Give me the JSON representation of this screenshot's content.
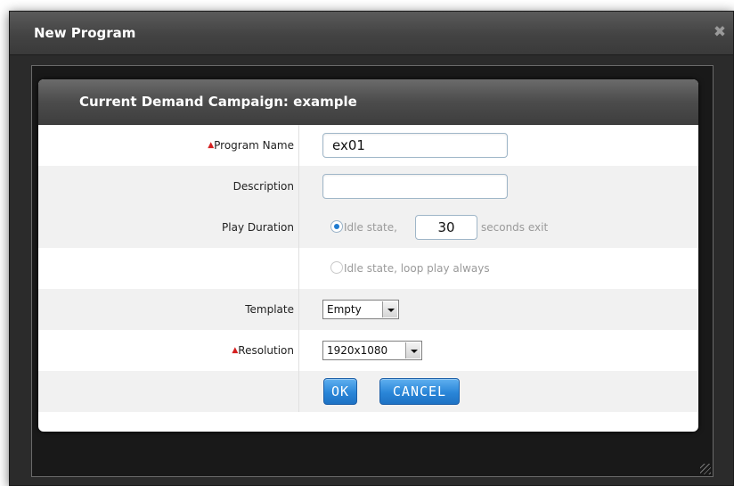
{
  "window": {
    "title": "New Program"
  },
  "dialog": {
    "title": "Current Demand Campaign: example"
  },
  "form": {
    "program_name": {
      "label": "Program Name",
      "required": "▲",
      "value": "ex01"
    },
    "description": {
      "label": "Description",
      "value": ""
    },
    "play_duration": {
      "label": "Play Duration",
      "option1_prefix": "Idle state,",
      "seconds_value": "30",
      "option1_suffix": "seconds exit",
      "option2": "Idle state, loop play always",
      "selected": "option1"
    },
    "template": {
      "label": "Template",
      "selected": "Empty"
    },
    "resolution": {
      "label": "Resolution",
      "required": "▲",
      "selected": "1920x1080"
    }
  },
  "buttons": {
    "ok": "OK",
    "cancel": "CANCEL"
  },
  "icons": {
    "close": "close-icon",
    "resize": "resize-grip-icon"
  },
  "colors": {
    "accent": "#2a86d8",
    "required": "#d42020"
  }
}
